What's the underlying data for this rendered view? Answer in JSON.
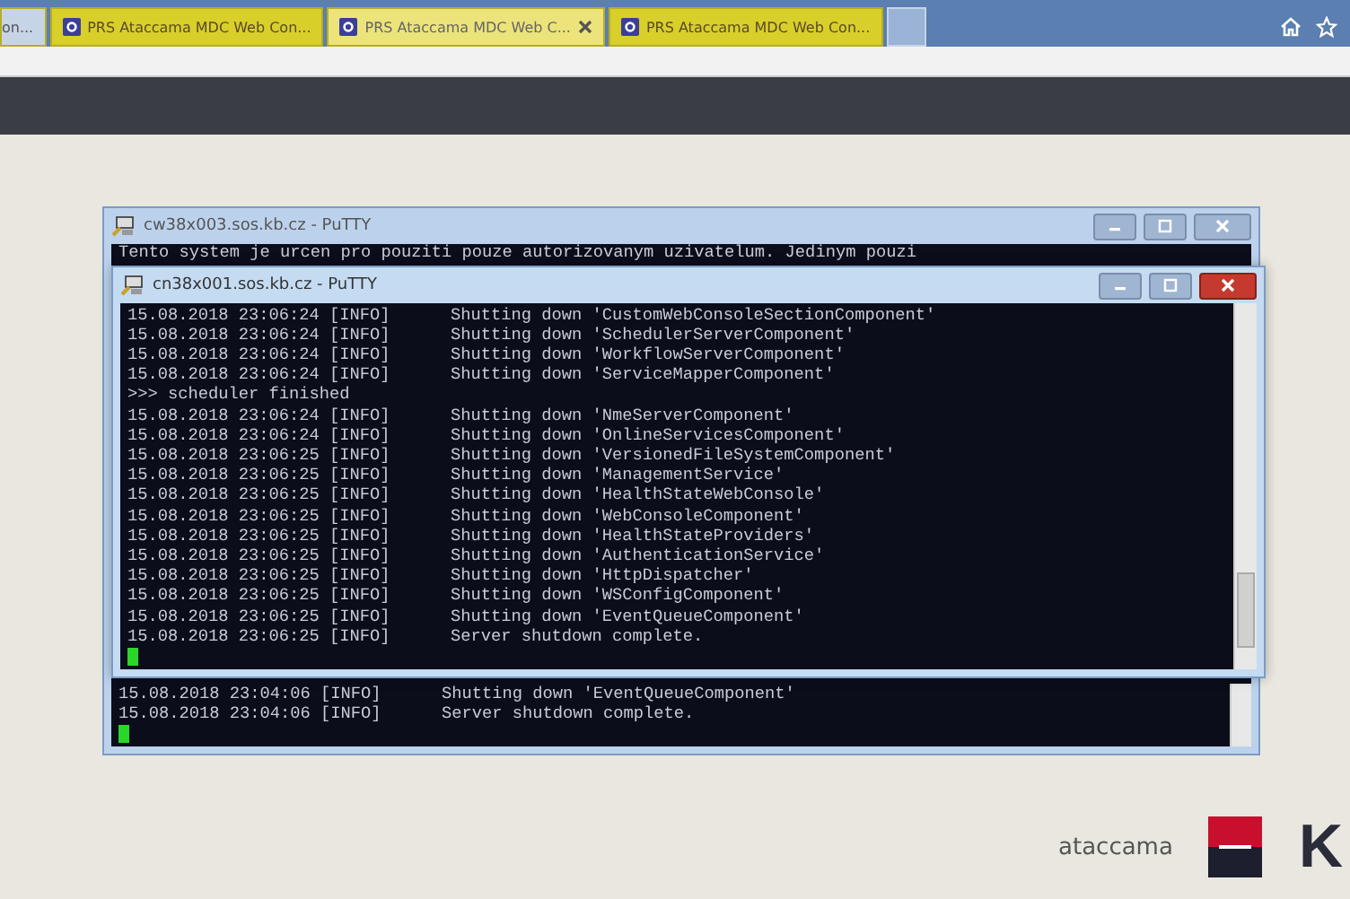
{
  "browser": {
    "tabs": [
      {
        "title": "on...",
        "selected": false
      },
      {
        "title": "PRS Ataccama MDC Web Con...",
        "selected": false
      },
      {
        "title": "PRS Ataccama MDC Web C...",
        "selected": true
      },
      {
        "title": "PRS Ataccama MDC Web Con...",
        "selected": false
      }
    ]
  },
  "windows": [
    {
      "title": "cw38x003.sos.kb.cz - PuTTY",
      "active": false,
      "head_lines": [
        "Tento system je urcen pro pouziti pouze autorizovanym uzivatelum. Jedinym pouzi"
      ],
      "lines": [
        "15.08.2018 23:04:06 [INFO]      Shutting down 'EventQueueComponent'",
        "15.08.2018 23:04:06 [INFO]      Server shutdown complete."
      ]
    },
    {
      "title": "cn38x001.sos.kb.cz - PuTTY",
      "active": true,
      "lines": [
        "15.08.2018 23:06:24 [INFO]      Shutting down 'CustomWebConsoleSectionComponent'",
        "15.08.2018 23:06:24 [INFO]      Shutting down 'SchedulerServerComponent'",
        "15.08.2018 23:06:24 [INFO]      Shutting down 'WorkflowServerComponent'",
        "15.08.2018 23:06:24 [INFO]      Shutting down 'ServiceMapperComponent'",
        ">>> scheduler finished",
        "15.08.2018 23:06:24 [INFO]      Shutting down 'NmeServerComponent'",
        "15.08.2018 23:06:24 [INFO]      Shutting down 'OnlineServicesComponent'",
        "15.08.2018 23:06:25 [INFO]      Shutting down 'VersionedFileSystemComponent'",
        "15.08.2018 23:06:25 [INFO]      Shutting down 'ManagementService'",
        "15.08.2018 23:06:25 [INFO]      Shutting down 'HealthStateWebConsole'",
        "15.08.2018 23:06:25 [INFO]      Shutting down 'WebConsoleComponent'",
        "15.08.2018 23:06:25 [INFO]      Shutting down 'HealthStateProviders'",
        "15.08.2018 23:06:25 [INFO]      Shutting down 'AuthenticationService'",
        "15.08.2018 23:06:25 [INFO]      Shutting down 'HttpDispatcher'",
        "15.08.2018 23:06:25 [INFO]      Shutting down 'WSConfigComponent'",
        "15.08.2018 23:06:25 [INFO]      Shutting down 'EventQueueComponent'",
        "15.08.2018 23:06:25 [INFO]      Server shutdown complete."
      ]
    }
  ],
  "footer": {
    "brand": "ataccama",
    "partner": "K"
  }
}
